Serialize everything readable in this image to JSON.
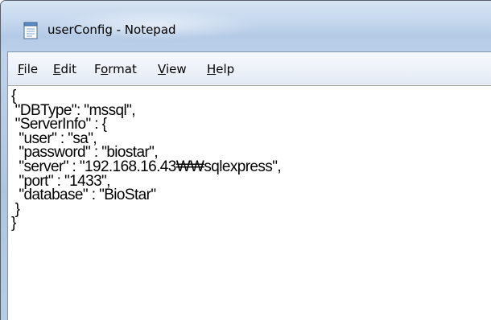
{
  "window": {
    "title": "userConfig - Notepad",
    "app_icon": "notepad-icon"
  },
  "menu": {
    "items": [
      {
        "label": "File",
        "accel": "F"
      },
      {
        "label": "Edit",
        "accel": "E"
      },
      {
        "label": "Format",
        "accel": "o"
      },
      {
        "label": "View",
        "accel": "V"
      },
      {
        "label": "Help",
        "accel": "H"
      }
    ]
  },
  "editor": {
    "lines": [
      "{",
      " \"DBType\": \"mssql\",",
      " \"ServerInfo\" : {",
      "  \"user\" : \"sa\",",
      "  \"password\" : \"biostar\",",
      "  \"server\" : \"192.168.16.43₩₩sqlexpress\",",
      "  \"port\" : \"1433\",",
      "  \"database\" : \"BioStar\"",
      " }",
      "}"
    ]
  },
  "colors": {
    "titlebar": "#c5d8ee",
    "menubar": "#eef2f9",
    "editor_bg": "#ffffff",
    "text": "#000000"
  }
}
